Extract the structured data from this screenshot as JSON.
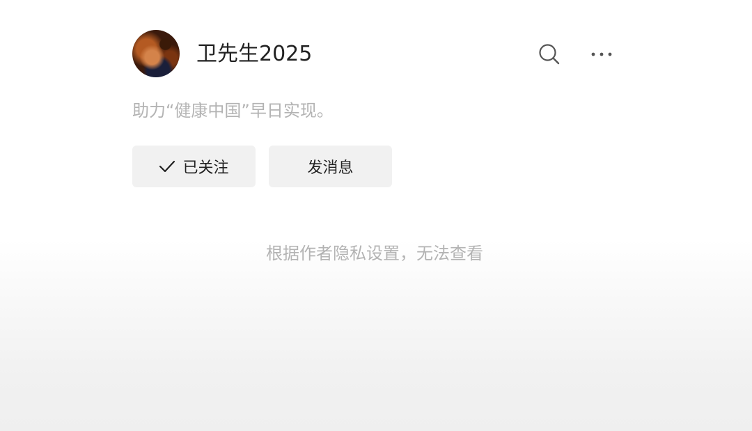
{
  "profile": {
    "username": "卫先生2025",
    "bio": "助力“健康中国”早日实现。"
  },
  "actions": {
    "follow_label": "已关注",
    "message_label": "发消息"
  },
  "notice": {
    "privacy_text": "根据作者隐私设置，无法查看"
  },
  "icons": {
    "search": "search-icon",
    "more": "more-dots-icon",
    "check": "check-icon"
  },
  "colors": {
    "text_primary": "#222222",
    "text_secondary": "#b3b3b3",
    "button_bg": "#f1f1f1"
  }
}
